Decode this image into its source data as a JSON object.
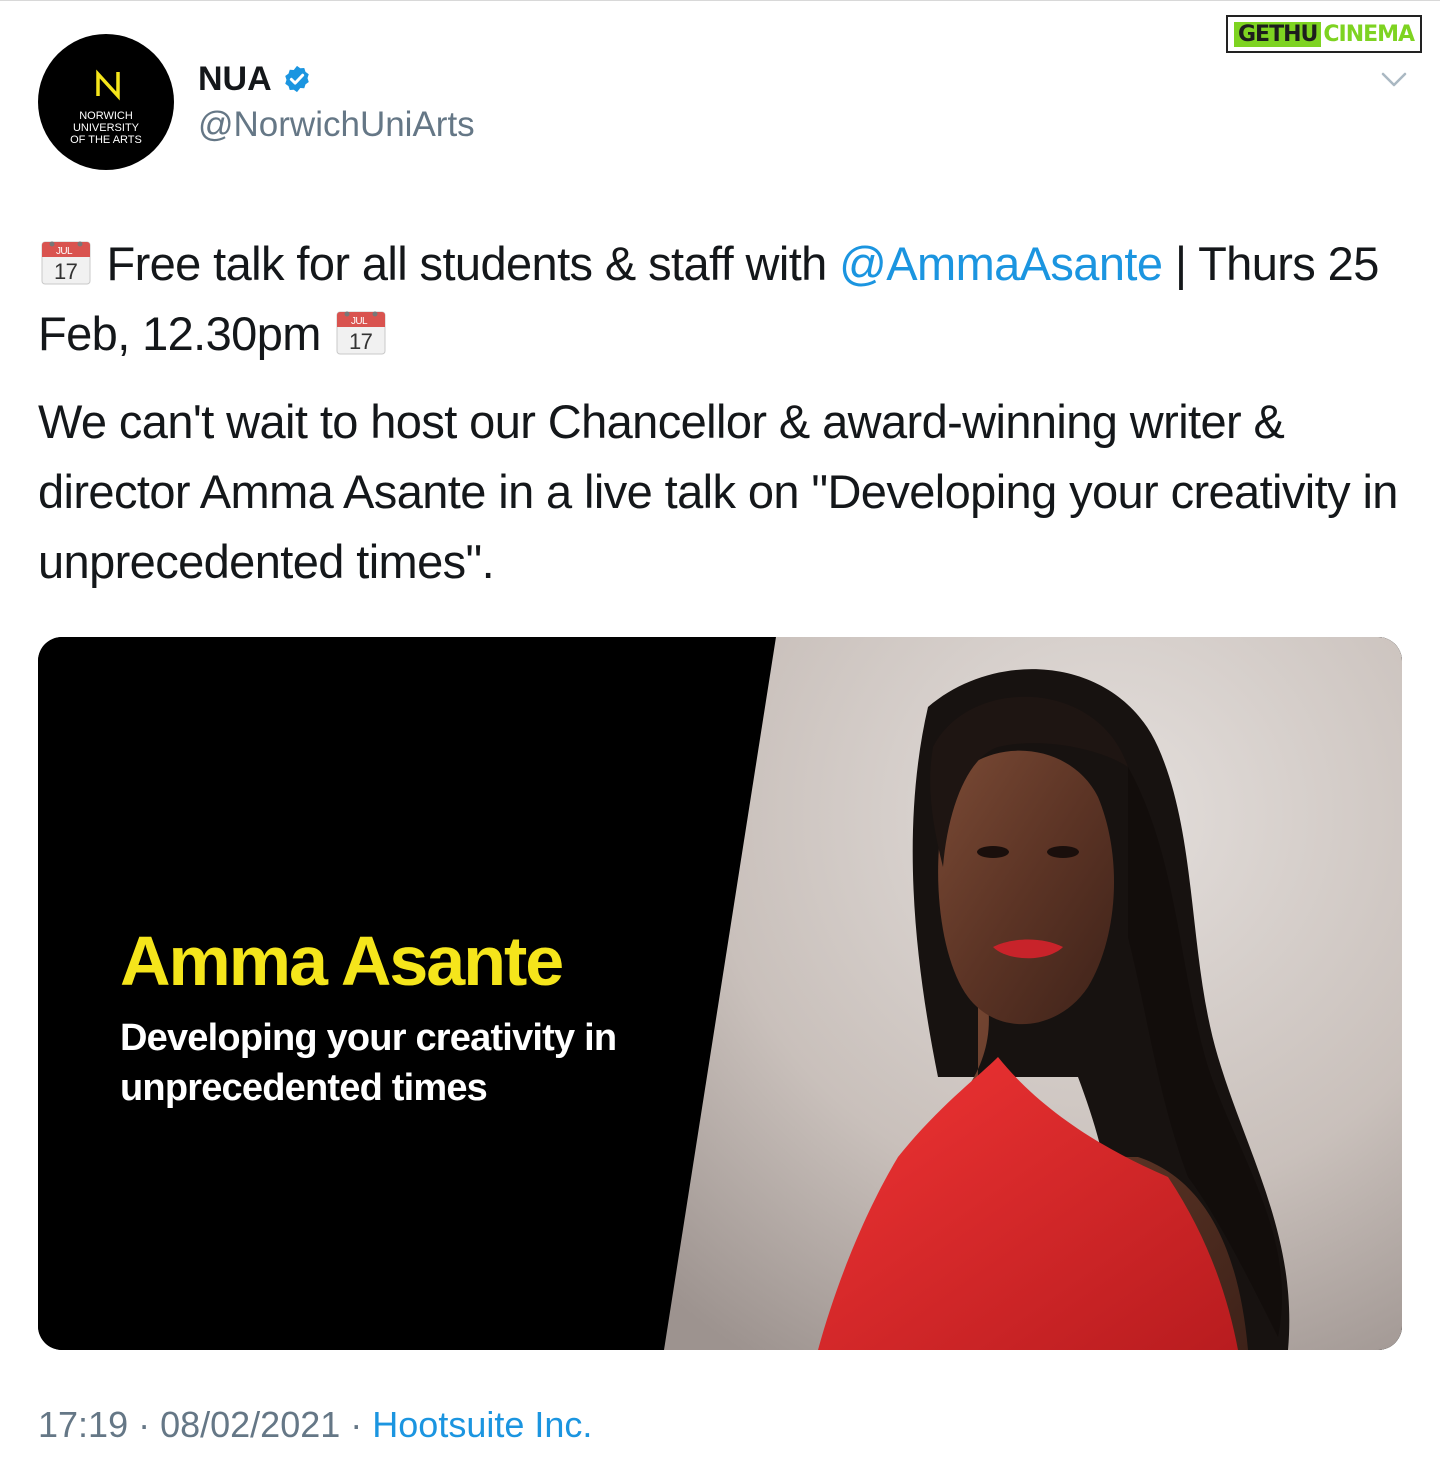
{
  "account": {
    "display_name": "NUA",
    "handle": "@NorwichUniArts",
    "avatar_lines": [
      "NORWICH",
      "UNIVERSITY",
      "OF THE ARTS"
    ]
  },
  "watermark": {
    "part1": "GETHU",
    "part2": "CINEMA"
  },
  "tweet": {
    "p1_text_a": "Free talk for all students & staff with ",
    "p1_mention": "@AmmaAsante",
    "p1_text_b": " | Thurs 25 Feb, 12.30pm ",
    "calendar_month": "JUL",
    "calendar_day": "17",
    "p2_text": "We can't wait to host our Chancellor & award-winning writer & director Amma Asante in a live talk on \"Developing your creativity in unprecedented times\"."
  },
  "media": {
    "title": "Amma Asante",
    "subtitle": "Developing your creativity in unprecedented times"
  },
  "footer": {
    "time": "17:19",
    "separator": " · ",
    "date": "08/02/2021",
    "source": "Hootsuite Inc."
  },
  "colors": {
    "link": "#1b95e0",
    "muted": "#657786",
    "title_yellow": "#f5e51b",
    "dress_red": "#e0262a",
    "watermark_green": "#7ed321"
  },
  "icons": [
    "verified-badge-icon",
    "chevron-down-icon",
    "calendar-icon",
    "nua-logo-icon"
  ]
}
